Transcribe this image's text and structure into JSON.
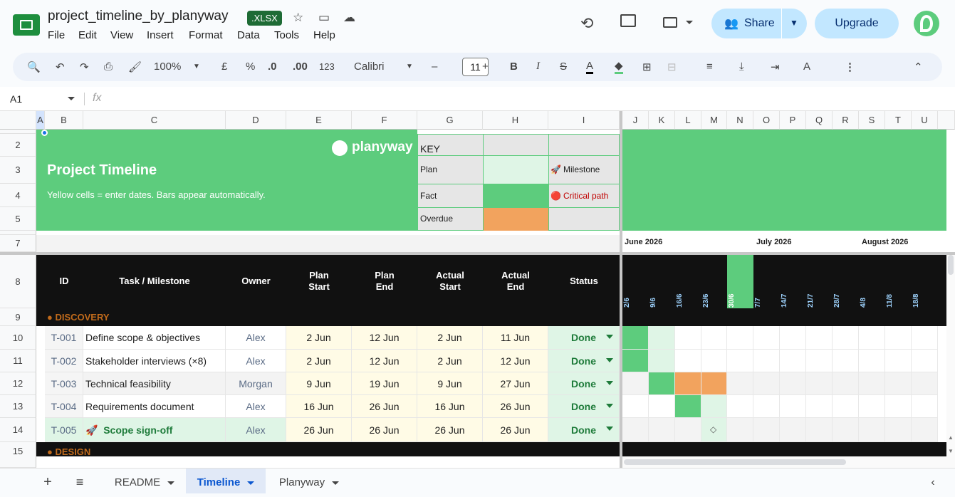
{
  "app": {
    "doc_title": "project_timeline_by_planyway",
    "file_badge": ".XLSX",
    "menu": [
      "File",
      "Edit",
      "View",
      "Insert",
      "Format",
      "Data",
      "Tools",
      "Help"
    ],
    "share_label": "Share",
    "upgrade_label": "Upgrade"
  },
  "toolbar": {
    "zoom": "100%",
    "currency": "£",
    "percent": "%",
    "dec_minus": ".0",
    "dec_plus": ".00",
    "num_format": "123",
    "font": "Calibri",
    "font_size": "11",
    "minus": "–",
    "plus": "+"
  },
  "formula": {
    "name_box": "A1",
    "fx": "fx"
  },
  "columns": [
    "A",
    "B",
    "C",
    "D",
    "E",
    "F",
    "G",
    "H",
    "I",
    "J",
    "K",
    "L",
    "M",
    "N",
    "O",
    "P",
    "Q",
    "R",
    "S",
    "T",
    "U"
  ],
  "rows": [
    "2",
    "3",
    "4",
    "5",
    "7",
    "8",
    "9",
    "10",
    "11",
    "12",
    "13",
    "14",
    "15"
  ],
  "header": {
    "brand": "planyway",
    "title": "Project Timeline",
    "subtitle": "Yellow cells = enter dates. Bars appear automatically.",
    "key_title": "KEY",
    "key_plan": "Plan",
    "key_fact": "Fact",
    "key_overdue": "Overdue",
    "key_milestone": "Milestone",
    "key_critical": "Critical path",
    "milestone_icon": "🚀",
    "critical_icon": "🔴"
  },
  "months": [
    "June 2026",
    "July 2026",
    "August 2026"
  ],
  "table_headers": {
    "id": "ID",
    "task": "Task / Milestone",
    "owner": "Owner",
    "plan_start_1": "Plan",
    "plan_start_2": "Start",
    "plan_end_1": "Plan",
    "plan_end_2": "End",
    "actual_start_1": "Actual",
    "actual_start_2": "Start",
    "actual_end_1": "Actual",
    "actual_end_2": "End",
    "status": "Status"
  },
  "week_dates": [
    "2/6",
    "9/6",
    "16/6",
    "23/6",
    "30/6",
    "7/7",
    "14/7",
    "21/7",
    "28/7",
    "4/8",
    "11/8",
    "18/8"
  ],
  "sections": {
    "discovery": "● DISCOVERY",
    "design": "● DESIGN"
  },
  "tasks": [
    {
      "id": "T-001",
      "task": "Define scope & objectives",
      "owner": "Alex",
      "plan_start": "2 Jun",
      "plan_end": "12 Jun",
      "actual_start": "2 Jun",
      "actual_end": "11 Jun",
      "status": "Done"
    },
    {
      "id": "T-002",
      "task": "Stakeholder interviews (×8)",
      "owner": "Alex",
      "plan_start": "2 Jun",
      "plan_end": "12 Jun",
      "actual_start": "2 Jun",
      "actual_end": "12 Jun",
      "status": "Done"
    },
    {
      "id": "T-003",
      "task": "Technical feasibility",
      "owner": "Morgan",
      "plan_start": "9 Jun",
      "plan_end": "19 Jun",
      "actual_start": "9 Jun",
      "actual_end": "27 Jun",
      "status": "Done"
    },
    {
      "id": "T-004",
      "task": "Requirements document",
      "owner": "Alex",
      "plan_start": "16 Jun",
      "plan_end": "26 Jun",
      "actual_start": "16 Jun",
      "actual_end": "26 Jun",
      "status": "Done"
    },
    {
      "id": "T-005",
      "task": "Scope sign-off",
      "owner": "Alex",
      "plan_start": "26 Jun",
      "plan_end": "26 Jun",
      "actual_start": "26 Jun",
      "actual_end": "26 Jun",
      "status": "Done",
      "milestone_icon": "🚀"
    }
  ],
  "milestone_marker": "◇",
  "sheet_tabs": [
    "README",
    "Timeline",
    "Planyway"
  ],
  "colors": {
    "brand_green": "#5dcc7d",
    "overdue": "#f2a35e",
    "plan_light": "#dff5e6",
    "header_black": "#111111"
  }
}
